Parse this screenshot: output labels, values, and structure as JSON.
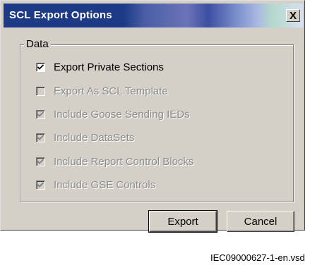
{
  "window": {
    "title": "SCL Export Options",
    "close_label": "X"
  },
  "group": {
    "label": "Data"
  },
  "options": [
    {
      "label": "Export Private Sections",
      "checked": true,
      "enabled": true
    },
    {
      "label": "Export As SCL Template",
      "checked": false,
      "enabled": false
    },
    {
      "label": "Include Goose Sending IEDs",
      "checked": true,
      "enabled": false
    },
    {
      "label": "Include DataSets",
      "checked": true,
      "enabled": false
    },
    {
      "label": "Include Report Control Blocks",
      "checked": true,
      "enabled": false
    },
    {
      "label": "Include GSE Controls",
      "checked": true,
      "enabled": false
    }
  ],
  "buttons": {
    "export_label": "Export",
    "cancel_label": "Cancel"
  },
  "caption": "IEC09000627-1-en.vsd"
}
